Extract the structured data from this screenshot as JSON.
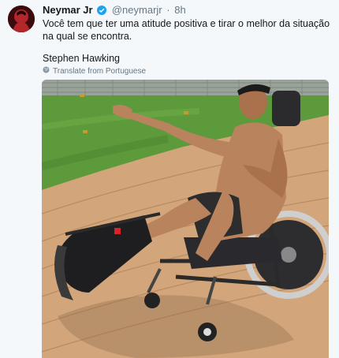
{
  "tweet": {
    "display_name": "Neymar Jr",
    "handle": "@neymarjr",
    "separator": "·",
    "time": "8h",
    "text": "Você tem que ter uma atitude positiva e tirar o melhor da situação na qual se encontra.",
    "author": "Stephen Hawking",
    "translate_label": "Translate from Portuguese"
  },
  "icons": {
    "verified": "verified-badge-icon",
    "globe": "globe-icon"
  },
  "colors": {
    "verified": "#1da1f2",
    "secondary_text": "#657786",
    "background": "#f5f8fa"
  }
}
